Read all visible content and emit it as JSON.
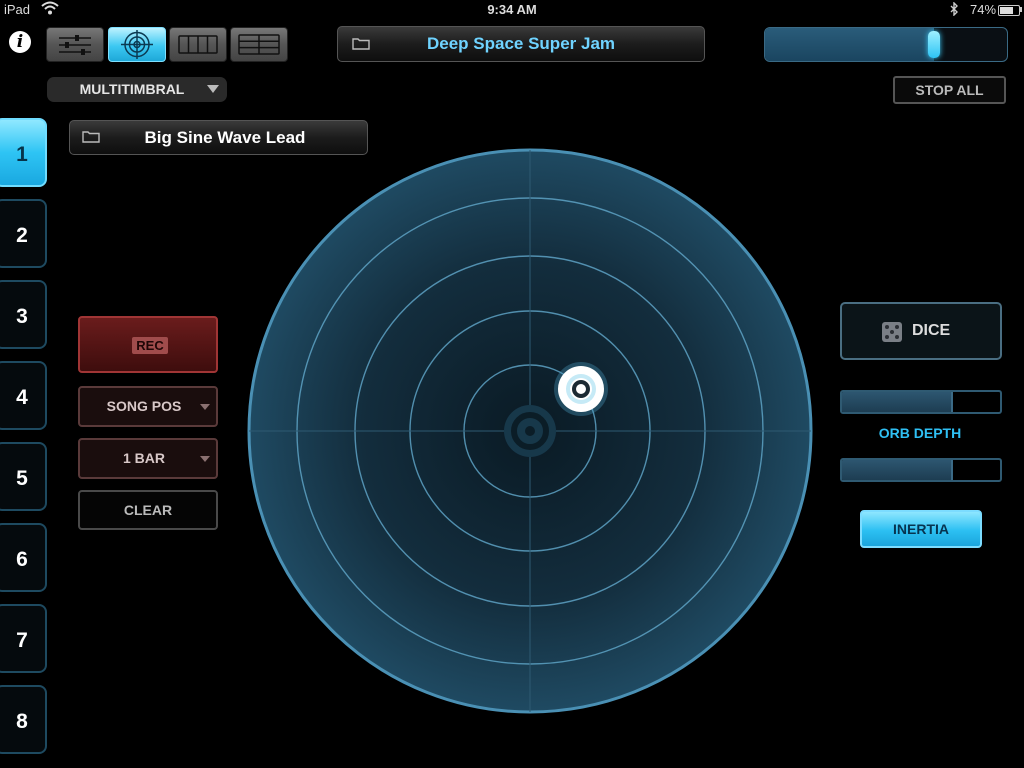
{
  "status_bar": {
    "device": "iPad",
    "time": "9:34 AM",
    "battery_percent": "74%",
    "battery_level": 0.74,
    "icons": [
      "wifi-icon",
      "bluetooth-icon",
      "battery-icon"
    ]
  },
  "toolbar": {
    "info_label": "i",
    "view_buttons": [
      {
        "icon": "mixer-icon",
        "active": false
      },
      {
        "icon": "target-icon",
        "active": true
      },
      {
        "icon": "columns-icon",
        "active": false
      },
      {
        "icon": "rows-icon",
        "active": false
      }
    ],
    "song_title": "Deep Space Super Jam",
    "volume_level": 0.7
  },
  "mode_selector": {
    "value": "MULTITIMBRAL"
  },
  "stop_all_label": "STOP ALL",
  "patch_name": "Big Sine Wave Lead",
  "channels": [
    {
      "label": "1",
      "active": true
    },
    {
      "label": "2",
      "active": false
    },
    {
      "label": "3",
      "active": false
    },
    {
      "label": "4",
      "active": false
    },
    {
      "label": "5",
      "active": false
    },
    {
      "label": "6",
      "active": false
    },
    {
      "label": "7",
      "active": false
    },
    {
      "label": "8",
      "active": false
    }
  ],
  "recorder": {
    "rec_label": "REC",
    "song_pos_label": "SONG POS",
    "bar_label": "1 BAR",
    "clear_label": "CLEAR"
  },
  "orb_controls": {
    "dice_label": "DICE",
    "orb_depth_label": "ORB DEPTH",
    "orb_depth_value": 0.69,
    "second_slider_value": 0.69,
    "inertia_label": "INERTIA",
    "inertia_active": true
  },
  "colors": {
    "accent": "#2ec4f4",
    "radar_fill": "#1c4258",
    "radar_line": "#4a90b4",
    "rec": "#a03535"
  }
}
